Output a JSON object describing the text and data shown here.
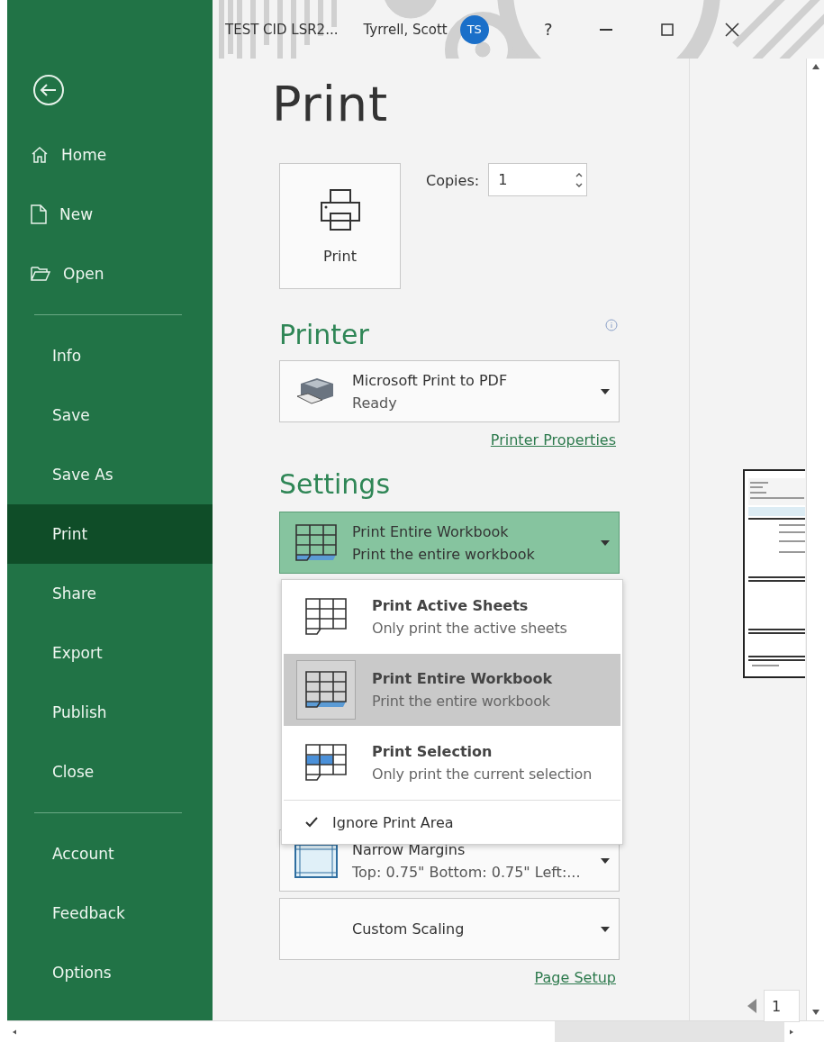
{
  "title_bar": {
    "document": "TEST CID LSR2...",
    "user": "Tyrrell, Scott",
    "avatar": "TS",
    "help": "?"
  },
  "sidebar": {
    "groups": [
      [
        {
          "label": "Home",
          "selected": false
        },
        {
          "label": "New",
          "selected": false
        },
        {
          "label": "Open",
          "selected": false
        }
      ],
      [
        {
          "label": "Info",
          "selected": false
        },
        {
          "label": "Save",
          "selected": false
        },
        {
          "label": "Save As",
          "selected": false
        },
        {
          "label": "Print",
          "selected": true
        },
        {
          "label": "Share",
          "selected": false
        },
        {
          "label": "Export",
          "selected": false
        },
        {
          "label": "Publish",
          "selected": false
        },
        {
          "label": "Close",
          "selected": false
        }
      ],
      [
        {
          "label": "Account",
          "selected": false
        },
        {
          "label": "Feedback",
          "selected": false
        },
        {
          "label": "Options",
          "selected": false
        }
      ]
    ]
  },
  "page_title": "Print",
  "print_button": "Print",
  "copies": {
    "label": "Copies:",
    "value": "1"
  },
  "printer": {
    "heading": "Printer",
    "name": "Microsoft Print to PDF",
    "status": "Ready",
    "properties_link": "Printer Properties"
  },
  "settings": {
    "heading": "Settings",
    "scope": {
      "title": "Print Entire Workbook",
      "subtitle": "Print the entire workbook",
      "expanded": true
    },
    "scope_menu": {
      "options": [
        {
          "kind": "sheets",
          "title": "Print Active Sheets",
          "subtitle": "Only print the active sheets",
          "selected": false
        },
        {
          "kind": "workbook",
          "title": "Print Entire Workbook",
          "subtitle": "Print the entire workbook",
          "selected": true
        },
        {
          "kind": "selection",
          "title": "Print Selection",
          "subtitle": "Only print the current selection",
          "selected": false
        }
      ],
      "ignore_print_area": {
        "label": "Ignore Print Area",
        "checked": true
      }
    },
    "margins": {
      "title": "Narrow Margins",
      "subtitle": "Top: 0.75\" Bottom: 0.75\" Left:..."
    },
    "scaling": {
      "title": "Custom Scaling"
    },
    "page_setup_link": "Page Setup"
  },
  "preview": {
    "page_number": "1"
  }
}
